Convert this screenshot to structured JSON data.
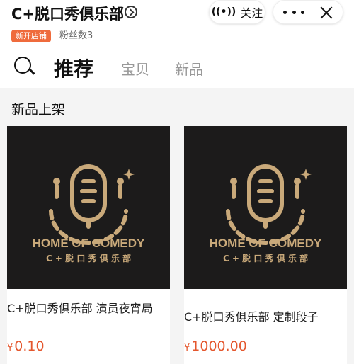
{
  "header": {
    "store_name": "C+脱口秀俱乐部",
    "follow_icon": "((•))",
    "follow_label": "关注",
    "badge": "新开店铺",
    "fans": "粉丝数3"
  },
  "tabs": [
    {
      "label": "推荐",
      "active": true
    },
    {
      "label": "宝贝",
      "active": false
    },
    {
      "label": "新品",
      "active": false
    }
  ],
  "section": {
    "title": "新品上架"
  },
  "products": [
    {
      "logo_text": "HOME OF COMEDY",
      "logo_sub": "C + 脱 口 秀 俱 乐 部",
      "title": "C+脱口秀俱乐部 演员夜宵局",
      "currency": "¥",
      "price": "0.10"
    },
    {
      "logo_text": "HOME OF COMEDY",
      "logo_sub": "C + 脱 口 秀 俱 乐 部",
      "title": "C+脱口秀俱乐部 定制段子",
      "currency": "¥",
      "price": "1000.00"
    }
  ],
  "colors": {
    "accent": "#e4572e",
    "badge": "#ef6b3c",
    "logo_gold": "#c9a97a",
    "card_dark": "#1c1b1b"
  }
}
